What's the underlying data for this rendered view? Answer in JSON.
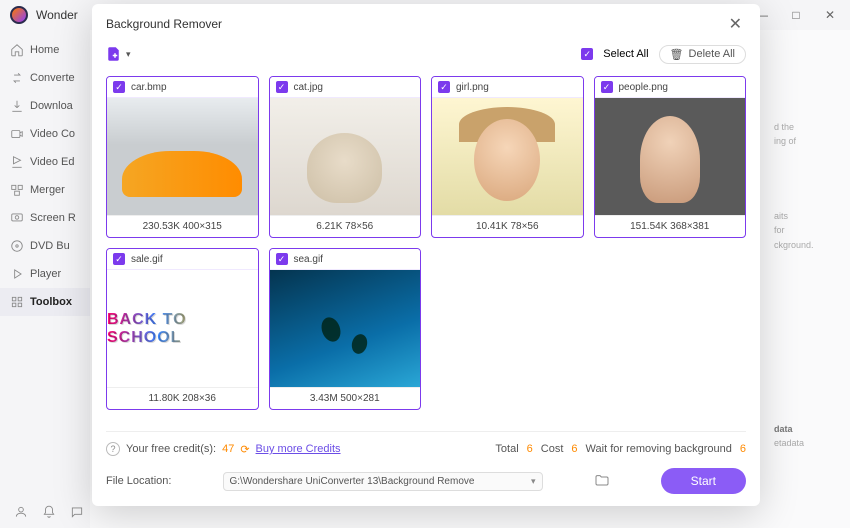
{
  "app": {
    "title_visible": "Wonder"
  },
  "window_controls": {
    "min": "—",
    "max": "□",
    "close": "✕"
  },
  "sidebar": {
    "items": [
      {
        "icon": "home",
        "label": "Home"
      },
      {
        "icon": "convert",
        "label": "Converte"
      },
      {
        "icon": "download",
        "label": "Downloa"
      },
      {
        "icon": "videoc",
        "label": "Video Co"
      },
      {
        "icon": "videoe",
        "label": "Video Ed"
      },
      {
        "icon": "merger",
        "label": "Merger"
      },
      {
        "icon": "screen",
        "label": "Screen R"
      },
      {
        "icon": "dvd",
        "label": "DVD Bu"
      },
      {
        "icon": "player",
        "label": "Player"
      },
      {
        "icon": "toolbox",
        "label": "Toolbox"
      }
    ],
    "active_index": 9
  },
  "modal": {
    "title": "Background Remover",
    "select_all": "Select All",
    "delete_all": "Delete All",
    "files": [
      {
        "name": "car.bmp",
        "info": "230.53K  400×315",
        "thumb": "car"
      },
      {
        "name": "cat.jpg",
        "info": "6.21K  78×56",
        "thumb": "cat"
      },
      {
        "name": "girl.png",
        "info": "10.41K  78×56",
        "thumb": "girl"
      },
      {
        "name": "people.png",
        "info": "151.54K  368×381",
        "thumb": "people"
      },
      {
        "name": "sale.gif",
        "info": "11.80K  208×36",
        "thumb": "sale"
      },
      {
        "name": "sea.gif",
        "info": "3.43M  500×281",
        "thumb": "sea"
      }
    ],
    "credits": {
      "label": "Your free credit(s):",
      "count": "47",
      "refresh": "⟳",
      "buy": "Buy more Credits",
      "total_label": "Total",
      "total": "6",
      "cost_label": "Cost",
      "cost": "6",
      "wait_label": "Wait for removing background",
      "wait": "6"
    },
    "footer": {
      "loc_label": "File Location:",
      "loc_value": "G:\\Wondershare UniConverter 13\\Background Remove",
      "start": "Start"
    }
  },
  "right_shim": {
    "l1": "d the",
    "l2": "ing of",
    "l3": "aits",
    "l4": "for",
    "l5": "ckground.",
    "l6": "data",
    "l7": "etadata"
  },
  "sale_text": "BACK TO SCHOOL"
}
